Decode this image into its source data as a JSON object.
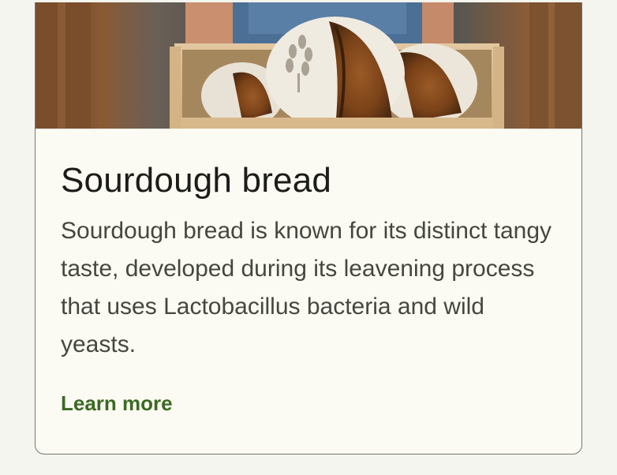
{
  "card": {
    "image_alt": "Sourdough loaves in a wooden crate",
    "title": "Sourdough bread",
    "description": "Sourdough bread is known for its distinct tangy taste, developed during its leavening process that uses Lactobacillus bacteria and wild yeasts.",
    "link_label": "Learn more"
  },
  "colors": {
    "background": "#f4f5ee",
    "card_surface": "#fcfbf3",
    "card_outline": "#74776f",
    "title_text": "#1c1c19",
    "body_text": "#45473f",
    "link_text": "#3b6b22"
  }
}
